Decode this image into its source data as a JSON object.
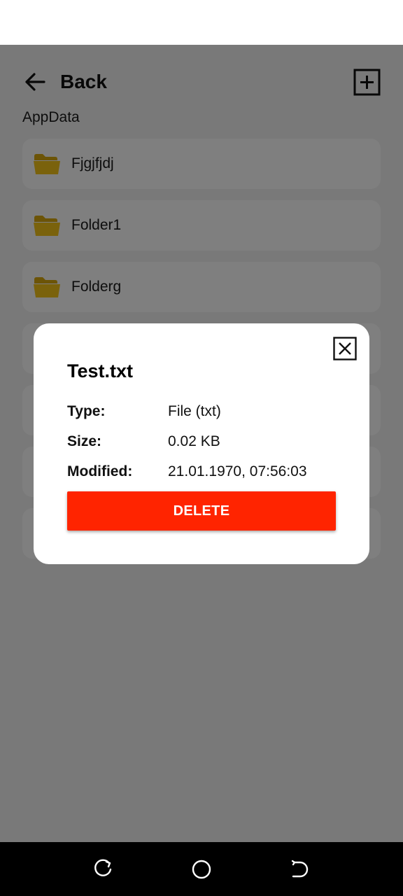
{
  "header": {
    "back_label": "Back",
    "back_icon": "arrow-left-icon",
    "add_icon": "plus-square-icon"
  },
  "path": "AppData",
  "list": [
    {
      "name": "Fjgjfjdj",
      "icon": "folder-icon"
    },
    {
      "name": "Folder1",
      "icon": "folder-icon"
    },
    {
      "name": "Folderg",
      "icon": "folder-icon"
    },
    {
      "name": "",
      "icon": ""
    },
    {
      "name": "",
      "icon": ""
    },
    {
      "name": "",
      "icon": ""
    },
    {
      "name": "",
      "icon": ""
    }
  ],
  "dialog": {
    "title": "Test.txt",
    "rows": [
      {
        "label": "Type:",
        "value": "File (txt)"
      },
      {
        "label": "Size:",
        "value": "0.02 KB"
      },
      {
        "label": "Modified:",
        "value": "21.01.1970, 07:56:03"
      }
    ],
    "delete_label": "DELETE",
    "close_icon": "close-box-icon"
  },
  "colors": {
    "delete": "#ff2400",
    "folder": "#f5c518",
    "scrim": "rgba(0,0,0,0.5)"
  },
  "nav": {
    "recent_icon": "recent-apps-icon",
    "home_icon": "home-circle-icon",
    "back_icon": "nav-back-icon"
  }
}
